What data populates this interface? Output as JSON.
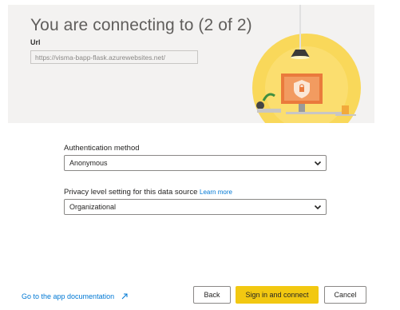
{
  "header": {
    "title": "You are connecting to (2 of 2)",
    "url_label": "Url",
    "url_value": "https://visma-bapp-flask.azurewebsites.net/"
  },
  "auth": {
    "label": "Authentication method",
    "selected": "Anonymous"
  },
  "privacy": {
    "label": "Privacy level setting for this data source",
    "learn_more": "Learn more",
    "selected": "Organizational"
  },
  "footer": {
    "doc_link": "Go to the app documentation",
    "back": "Back",
    "sign_in": "Sign in and connect",
    "cancel": "Cancel"
  },
  "colors": {
    "accent": "#f2c811",
    "link": "#0078d4",
    "header_bg": "#f3f2f1"
  },
  "icons": [
    "chevron-down-icon",
    "external-link-icon",
    "security-illustration"
  ]
}
